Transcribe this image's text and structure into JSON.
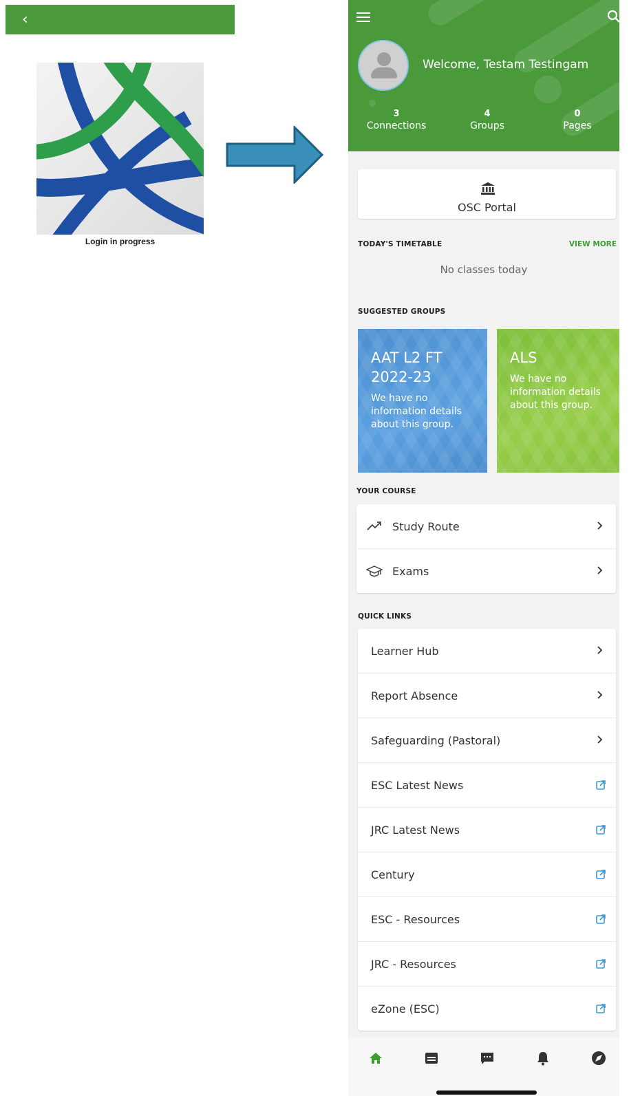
{
  "left_screen": {
    "back_label": "‹",
    "status_text": "Login in progress"
  },
  "phone": {
    "header": {
      "welcome_text": "Welcome, Testam Testingam",
      "stats": [
        {
          "value": "3",
          "label": "Connections"
        },
        {
          "value": "4",
          "label": "Groups"
        },
        {
          "value": "0",
          "label": "Pages"
        }
      ]
    },
    "portal": {
      "label": "OSC Portal",
      "icon": "bank-icon"
    },
    "timetable": {
      "title": "TODAY'S TIMETABLE",
      "view_more": "VIEW MORE",
      "empty_text": "No classes today"
    },
    "suggested_groups": {
      "title": "SUGGESTED GROUPS",
      "items": [
        {
          "title": "AAT L2 FT 2022-23",
          "description": "We have no information details about this group.",
          "color": "#4c8fd0"
        },
        {
          "title": "ALS",
          "description": "We have no information details about this group.",
          "color": "#86c23e"
        }
      ]
    },
    "your_course": {
      "title": "YOUR COURSE",
      "items": [
        {
          "label": "Study Route",
          "icon": "trending-icon"
        },
        {
          "label": "Exams",
          "icon": "graduation-cap-icon"
        }
      ]
    },
    "quick_links": {
      "title": "QUICK LINKS",
      "items": [
        {
          "label": "Learner Hub",
          "type": "chevron"
        },
        {
          "label": "Report Absence",
          "type": "chevron"
        },
        {
          "label": "Safeguarding (Pastoral)",
          "type": "chevron"
        },
        {
          "label": "ESC Latest News",
          "type": "external"
        },
        {
          "label": "JRC Latest News",
          "type": "external"
        },
        {
          "label": "Century",
          "type": "external"
        },
        {
          "label": "ESC - Resources",
          "type": "external"
        },
        {
          "label": "JRC - Resources",
          "type": "external"
        },
        {
          "label": "eZone (ESC)",
          "type": "external"
        }
      ]
    },
    "bottom_nav": [
      "home-icon",
      "calendar-icon",
      "chat-icon",
      "bell-icon",
      "compass-icon"
    ],
    "colors": {
      "brand_green": "#4a9a3c",
      "link_green": "#3f9c35",
      "external_link": "#3d9ad6"
    }
  }
}
